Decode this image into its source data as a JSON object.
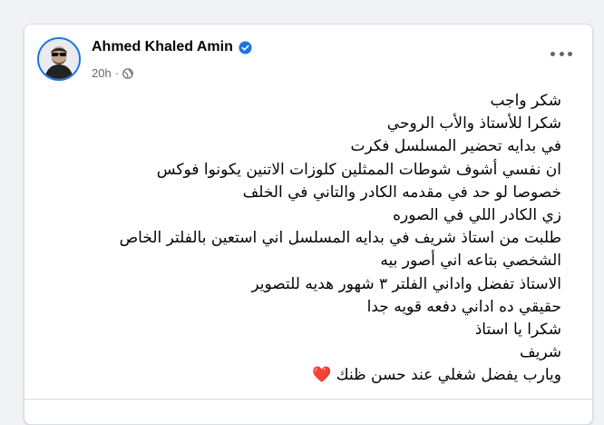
{
  "post": {
    "author": "Ahmed Khaled Amin",
    "timestamp": "20h",
    "audience_icon": "globe-icon",
    "verified_icon": "verified-badge-icon",
    "more_icon": "more-options-icon",
    "lines": [
      "شكر واجب",
      "شكرا للأستاذ والأب الروحي",
      "في بدايه تحضير المسلسل فكرت",
      "ان نفسي أشوف شوطات الممثلين  كلوزات الاتنين يكونوا فوكس",
      "خصوصا لو حد في مقدمه الكادر والتاني في الخلف",
      "زي الكادر اللي في الصوره",
      "طلبت من استاذ شريف في بدايه المسلسل اني استعين بالفلتر الخاص",
      "الشخصي بتاعه اني أصور بيه",
      "الاستاذ تفضل واداني الفلتر ٣ شهور هديه للتصوير",
      "حقيقي ده اداني دفعه قويه جدا",
      "شكرا يا استاذ",
      "شريف",
      "ويارب يفضل شغلي عند حسن ظنك"
    ],
    "end_emoji": "❤️"
  },
  "colors": {
    "verified": "#1b74e4",
    "heart": "#e41e3f"
  }
}
